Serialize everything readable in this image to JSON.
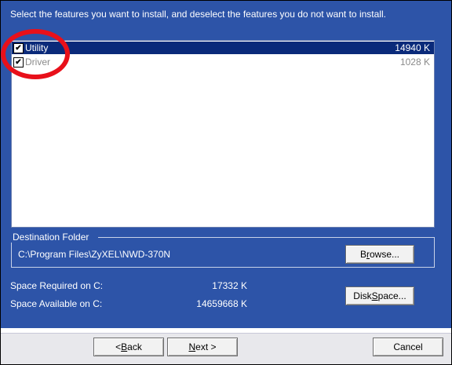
{
  "instruction": "Select the features you want to install, and deselect the features you do not want to install.",
  "features": [
    {
      "name": "Utility",
      "size": "14940 K",
      "checked": true,
      "selected": true
    },
    {
      "name": "Driver",
      "size": "1028 K",
      "checked": true,
      "selected": false
    }
  ],
  "destination": {
    "legend": "Destination Folder",
    "path": "C:\\Program Files\\ZyXEL\\NWD-370N",
    "browse_prefix": "B",
    "browse_underline": "r",
    "browse_suffix": "owse..."
  },
  "space": {
    "required_label": "Space Required on C:",
    "required_value": "17332 K",
    "available_label": "Space Available on C:",
    "available_value": "14659668 K",
    "disk_prefix": "Disk ",
    "disk_underline": "S",
    "disk_suffix": "pace..."
  },
  "buttons": {
    "back_prefix": "< ",
    "back_underline": "B",
    "back_suffix": "ack",
    "next_underline": "N",
    "next_suffix": "ext >",
    "cancel": "Cancel"
  },
  "colors": {
    "panel_blue": "#2d54a8",
    "selection": "#0a2a7a",
    "highlight_circle": "#e8101a"
  }
}
